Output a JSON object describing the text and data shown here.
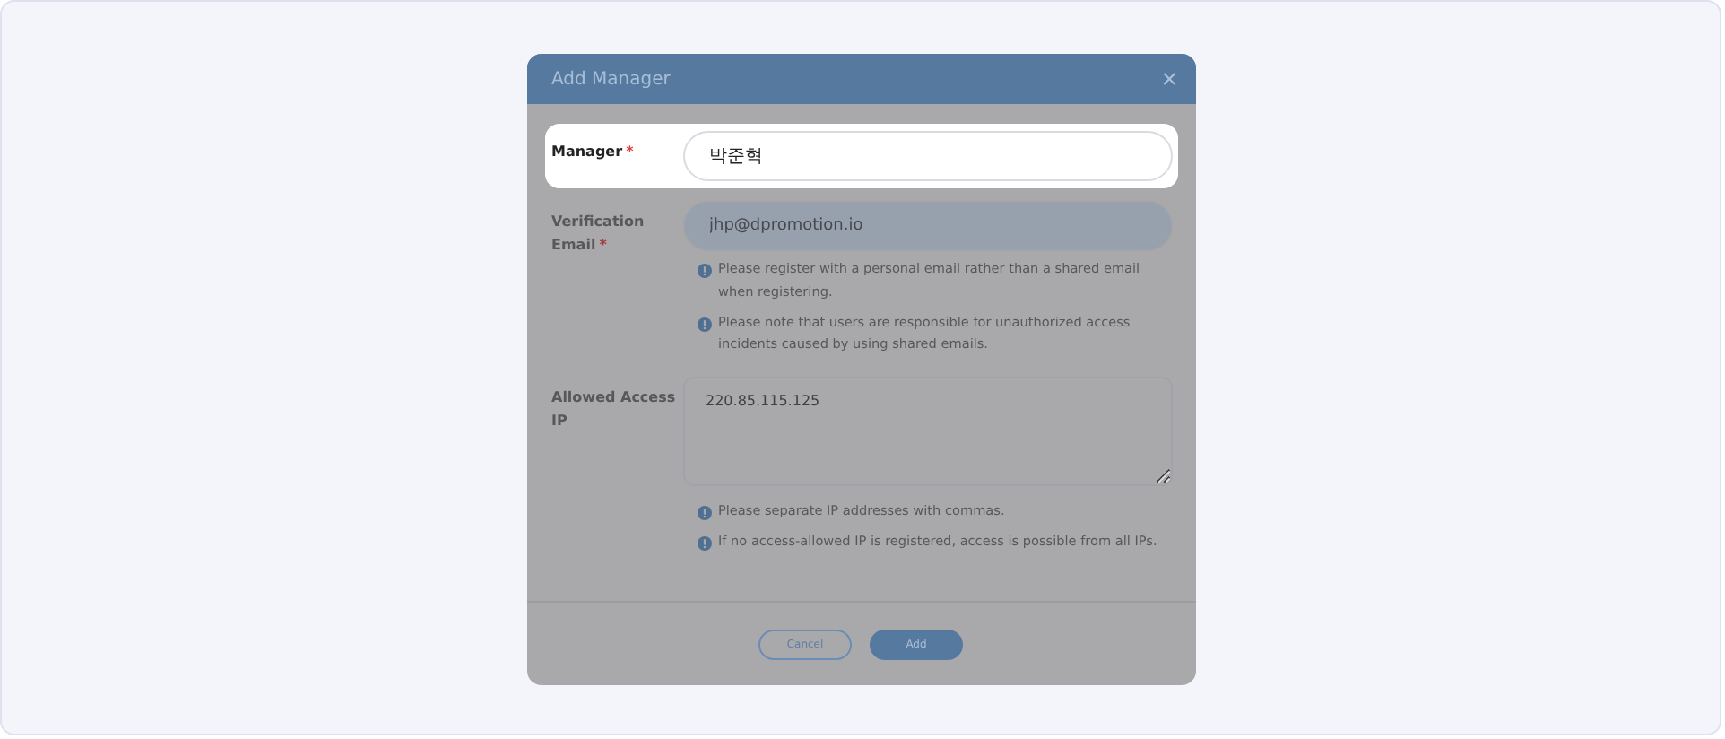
{
  "dialog": {
    "title": "Add Manager",
    "close": "×"
  },
  "fields": [
    {
      "kind": "input",
      "label": "Manager",
      "required_mark": "*",
      "highlighted": true,
      "value": "박준혁"
    },
    {
      "kind": "input",
      "label": "Verification Email",
      "required_mark": "*",
      "highlighted": false,
      "value": "jhp@dpromotion.io",
      "notes": [
        "Please register with a personal email rather than a shared email when registering.",
        "Please note that users are responsible for unauthorized access incidents caused by using shared emails."
      ]
    },
    {
      "kind": "textarea",
      "label": "Allowed Access IP",
      "highlighted": false,
      "value": "220.85.115.125",
      "notes": [
        "Please separate IP addresses with commas.",
        "If no access-allowed IP is registered, access is possible from all IPs."
      ]
    }
  ],
  "buttons": [
    {
      "label": "Cancel",
      "kind": "secondary"
    },
    {
      "label": "Add",
      "kind": "primary"
    }
  ]
}
